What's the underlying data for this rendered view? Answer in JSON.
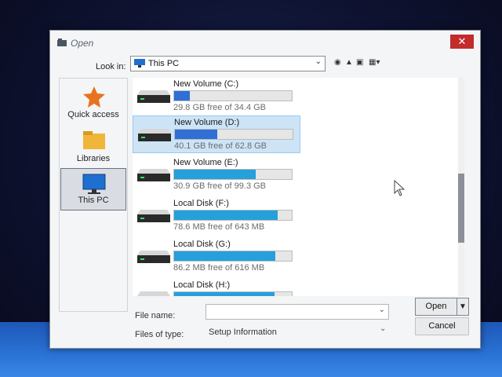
{
  "window": {
    "title": "Open",
    "close_glyph": "✕"
  },
  "lookin": {
    "label": "Look in:",
    "value": "This PC",
    "icon": "computer-icon"
  },
  "places": [
    {
      "label": "Quick access",
      "icon": "star-icon",
      "selected": false
    },
    {
      "label": "Libraries",
      "icon": "folder-icon",
      "selected": false
    },
    {
      "label": "This PC",
      "icon": "computer-icon",
      "selected": true
    }
  ],
  "drives": [
    {
      "name": "New Volume (C:)",
      "free_text": "29.8 GB free of 34.4 GB",
      "used_fraction": 0.13,
      "selected": false
    },
    {
      "name": "New Volume (D:)",
      "free_text": "40.1 GB free of 62.8 GB",
      "used_fraction": 0.36,
      "selected": true
    },
    {
      "name": "New Volume (E:)",
      "free_text": "30.9 GB free of 99.3 GB",
      "used_fraction": 0.69,
      "selected": false
    },
    {
      "name": "Local Disk (F:)",
      "free_text": "78.6 MB free of 643 MB",
      "used_fraction": 0.88,
      "selected": false
    },
    {
      "name": "Local Disk (G:)",
      "free_text": "86.2 MB free of 616 MB",
      "used_fraction": 0.86,
      "selected": false
    },
    {
      "name": "Local Disk (H:)",
      "free_text": "",
      "used_fraction": 0.85,
      "selected": false
    }
  ],
  "filename": {
    "label": "File name:",
    "value": ""
  },
  "filetype": {
    "label": "Files of type:",
    "value": "Setup Information"
  },
  "buttons": {
    "open": "Open",
    "cancel": "Cancel"
  },
  "colors": {
    "accent": "#26a0da",
    "selected_bg": "#cde4f7",
    "close": "#c42b2b"
  }
}
